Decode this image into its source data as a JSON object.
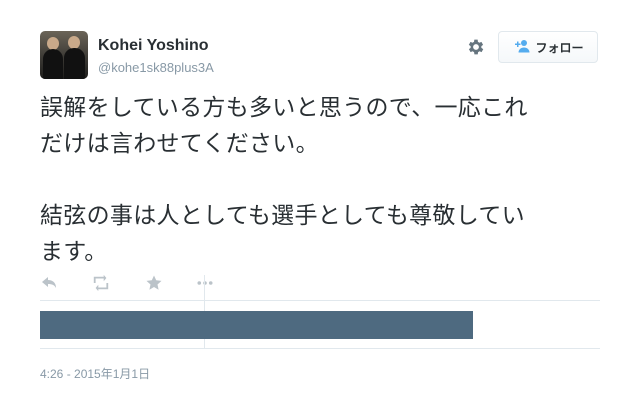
{
  "user": {
    "name": "Kohei Yoshino",
    "handle": "@kohe1sk88plus3A"
  },
  "icons": {
    "gear": "gear-icon",
    "follow": "person-add-icon",
    "reply": "reply-icon",
    "retweet": "retweet-icon",
    "favorite": "star-icon",
    "more": "more-icon"
  },
  "follow_button": {
    "label": "フォロー"
  },
  "tweet": {
    "text": "誤解をしている方も多いと思うので、一応これ\nだけは言わせてください。\n\n結弦の事は人としても選手としても尊敬してい\nます。"
  },
  "timestamp": "4:26 - 2015年1月1日",
  "colors": {
    "text": "#292f33",
    "muted": "#8899a6",
    "bar": "#4e6a80",
    "accent": "#55acee",
    "border": "#e1e8ed"
  }
}
